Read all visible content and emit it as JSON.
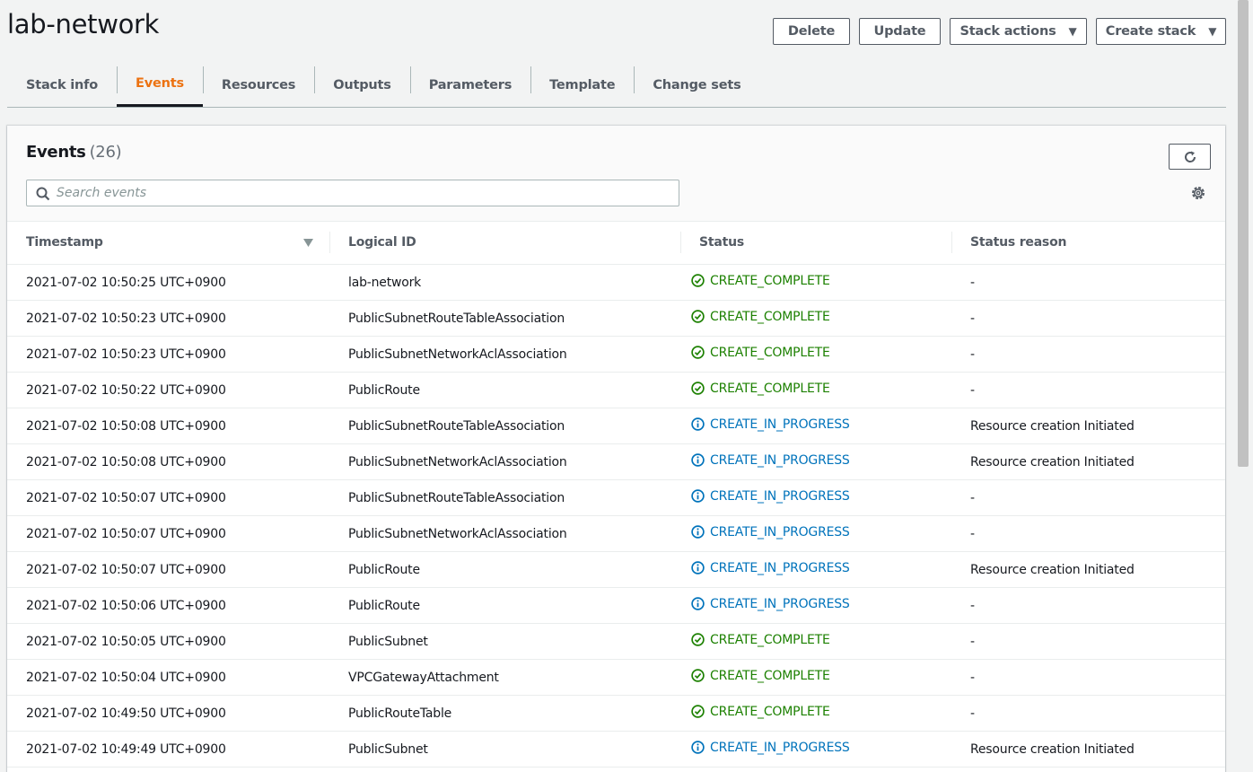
{
  "page": {
    "title": "lab-network"
  },
  "actions": {
    "delete": "Delete",
    "update": "Update",
    "stack_actions": "Stack actions",
    "create_stack": "Create stack"
  },
  "tabs": [
    "Stack info",
    "Events",
    "Resources",
    "Outputs",
    "Parameters",
    "Template",
    "Change sets"
  ],
  "active_tab": "Events",
  "events": {
    "title": "Events",
    "count": "(26)",
    "search_placeholder": "Search events",
    "columns": [
      "Timestamp",
      "Logical ID",
      "Status",
      "Status reason"
    ],
    "rows": [
      {
        "timestamp": "2021-07-02 10:50:25 UTC+0900",
        "logical_id": "lab-network",
        "status": "CREATE_COMPLETE",
        "type": "complete",
        "reason": "-"
      },
      {
        "timestamp": "2021-07-02 10:50:23 UTC+0900",
        "logical_id": "PublicSubnetRouteTableAssociation",
        "status": "CREATE_COMPLETE",
        "type": "complete",
        "reason": "-"
      },
      {
        "timestamp": "2021-07-02 10:50:23 UTC+0900",
        "logical_id": "PublicSubnetNetworkAclAssociation",
        "status": "CREATE_COMPLETE",
        "type": "complete",
        "reason": "-"
      },
      {
        "timestamp": "2021-07-02 10:50:22 UTC+0900",
        "logical_id": "PublicRoute",
        "status": "CREATE_COMPLETE",
        "type": "complete",
        "reason": "-"
      },
      {
        "timestamp": "2021-07-02 10:50:08 UTC+0900",
        "logical_id": "PublicSubnetRouteTableAssociation",
        "status": "CREATE_IN_PROGRESS",
        "type": "progress",
        "reason": "Resource creation Initiated"
      },
      {
        "timestamp": "2021-07-02 10:50:08 UTC+0900",
        "logical_id": "PublicSubnetNetworkAclAssociation",
        "status": "CREATE_IN_PROGRESS",
        "type": "progress",
        "reason": "Resource creation Initiated"
      },
      {
        "timestamp": "2021-07-02 10:50:07 UTC+0900",
        "logical_id": "PublicSubnetRouteTableAssociation",
        "status": "CREATE_IN_PROGRESS",
        "type": "progress",
        "reason": "-"
      },
      {
        "timestamp": "2021-07-02 10:50:07 UTC+0900",
        "logical_id": "PublicSubnetNetworkAclAssociation",
        "status": "CREATE_IN_PROGRESS",
        "type": "progress",
        "reason": "-"
      },
      {
        "timestamp": "2021-07-02 10:50:07 UTC+0900",
        "logical_id": "PublicRoute",
        "status": "CREATE_IN_PROGRESS",
        "type": "progress",
        "reason": "Resource creation Initiated"
      },
      {
        "timestamp": "2021-07-02 10:50:06 UTC+0900",
        "logical_id": "PublicRoute",
        "status": "CREATE_IN_PROGRESS",
        "type": "progress",
        "reason": "-"
      },
      {
        "timestamp": "2021-07-02 10:50:05 UTC+0900",
        "logical_id": "PublicSubnet",
        "status": "CREATE_COMPLETE",
        "type": "complete",
        "reason": "-"
      },
      {
        "timestamp": "2021-07-02 10:50:04 UTC+0900",
        "logical_id": "VPCGatewayAttachment",
        "status": "CREATE_COMPLETE",
        "type": "complete",
        "reason": "-"
      },
      {
        "timestamp": "2021-07-02 10:49:50 UTC+0900",
        "logical_id": "PublicRouteTable",
        "status": "CREATE_COMPLETE",
        "type": "complete",
        "reason": "-"
      },
      {
        "timestamp": "2021-07-02 10:49:49 UTC+0900",
        "logical_id": "PublicSubnet",
        "status": "CREATE_IN_PROGRESS",
        "type": "progress",
        "reason": "Resource creation Initiated"
      }
    ]
  },
  "colors": {
    "accent": "#ec7211",
    "complete": "#1d8102",
    "in_progress": "#0073bb"
  },
  "icons": {
    "refresh": "refresh-icon",
    "settings": "gear-icon",
    "search": "search-icon",
    "sort": "sort-down-icon",
    "complete": "check-circle-icon",
    "in_progress": "info-circle-icon"
  }
}
